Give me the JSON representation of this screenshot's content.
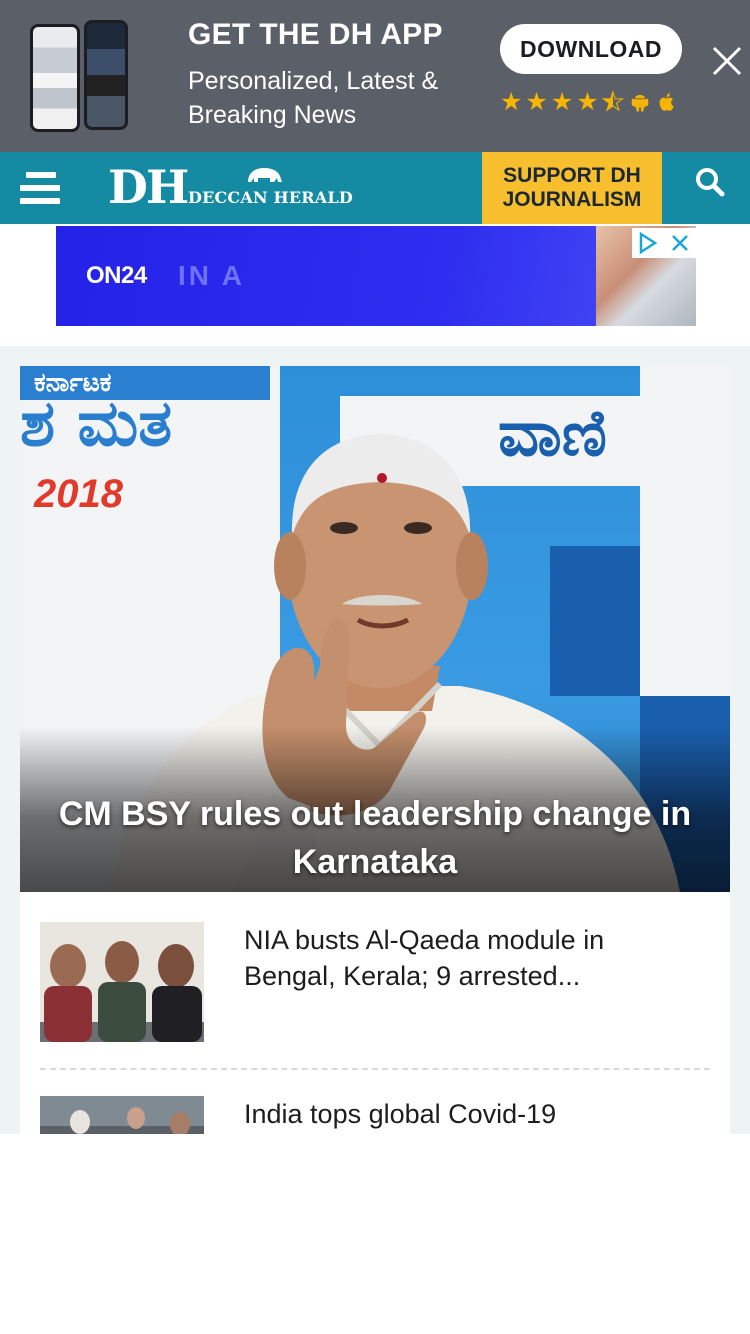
{
  "app_banner": {
    "title": "GET THE DH APP",
    "subtitle": "Personalized, Latest & Breaking News",
    "download_label": "DOWNLOAD",
    "rating_stars": 4.5,
    "platforms": [
      "android-icon",
      "apple-icon"
    ],
    "colors": {
      "background": "#5a5f68",
      "star": "#f7b500"
    }
  },
  "navbar": {
    "logo_mark": "DH",
    "logo_name": "DECCAN HERALD",
    "support_line1": "SUPPORT DH",
    "support_line2": "JOURNALISM",
    "colors": {
      "background": "#148aa3",
      "support": "#f7be2e"
    }
  },
  "ad": {
    "brand": "ON24",
    "text": "IN A"
  },
  "hero": {
    "title": "CM BSY rules out leadership change in Karnataka",
    "background_year": "2018",
    "background_text_left": "ಶ ಮತ",
    "background_text_right": "ವಾಣಿ",
    "background_text_top": "ಕರ್ನಾಟಕ"
  },
  "articles": [
    {
      "title": "NIA busts Al-Qaeda module in Bengal, Kerala; 9 arrested..."
    },
    {
      "title": "India tops global Covid-19"
    }
  ]
}
